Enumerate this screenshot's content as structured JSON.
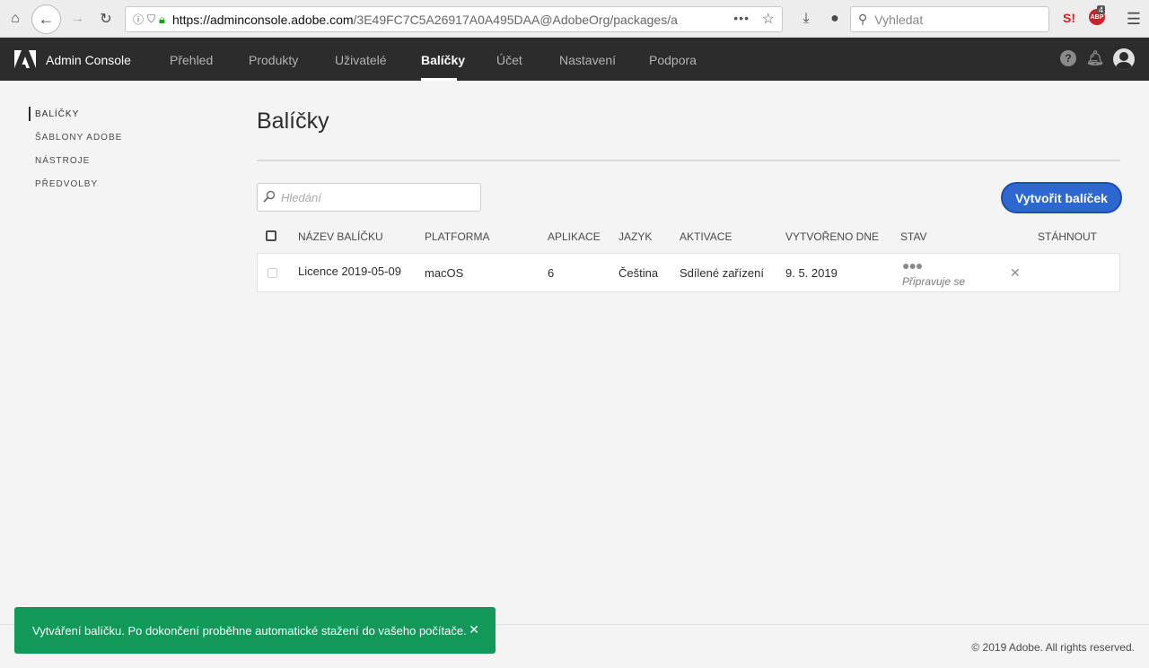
{
  "browser": {
    "url_host": "https://adminconsole.adobe.com",
    "url_rest": "/3E49FC7C5A26917A0A495DAA@AdobeOrg/packages/a",
    "search_placeholder": "Vyhledat",
    "abp_badge": "4",
    "s_ext_label": "S!",
    "abp_label": "ABP"
  },
  "app": {
    "title": "Admin Console",
    "nav": [
      "Přehled",
      "Produkty",
      "Uživatelé",
      "Balíčky",
      "Účet",
      "Nastavení",
      "Podpora"
    ],
    "active_nav": "Balíčky",
    "help_label": "?"
  },
  "sidebar": {
    "items": [
      "BALÍČKY",
      "ŠABLONY ADOBE",
      "NÁSTROJE",
      "PŘEDVOLBY"
    ]
  },
  "main": {
    "title": "Balíčky",
    "search_placeholder": "Hledání",
    "create_button": "Vytvořit balíček",
    "columns": [
      "NÁZEV BALÍČKU",
      "PLATFORMA",
      "APLIKACE",
      "JAZYK",
      "AKTIVACE",
      "VYTVOŘENO DNE",
      "STAV",
      "STÁHNOUT"
    ],
    "rows": [
      {
        "name": "Licence 2019-05-09",
        "platform": "macOS",
        "apps": "6",
        "language": "Čeština",
        "activation": "Sdílené zařízení",
        "created": "9. 5. 2019",
        "status_dots": "●●●",
        "status": "Připravuje se"
      }
    ]
  },
  "footer": {
    "copyright": "© 2019 Adobe. All rights reserved."
  },
  "toast": {
    "message": "Vytváření balíčku. Po dokončení proběhne automatické stažení do vašeho počítače."
  },
  "colors": {
    "header_bg": "#2c2c2c",
    "primary_button": "#2d67d0",
    "toast_bg": "#12995a"
  }
}
